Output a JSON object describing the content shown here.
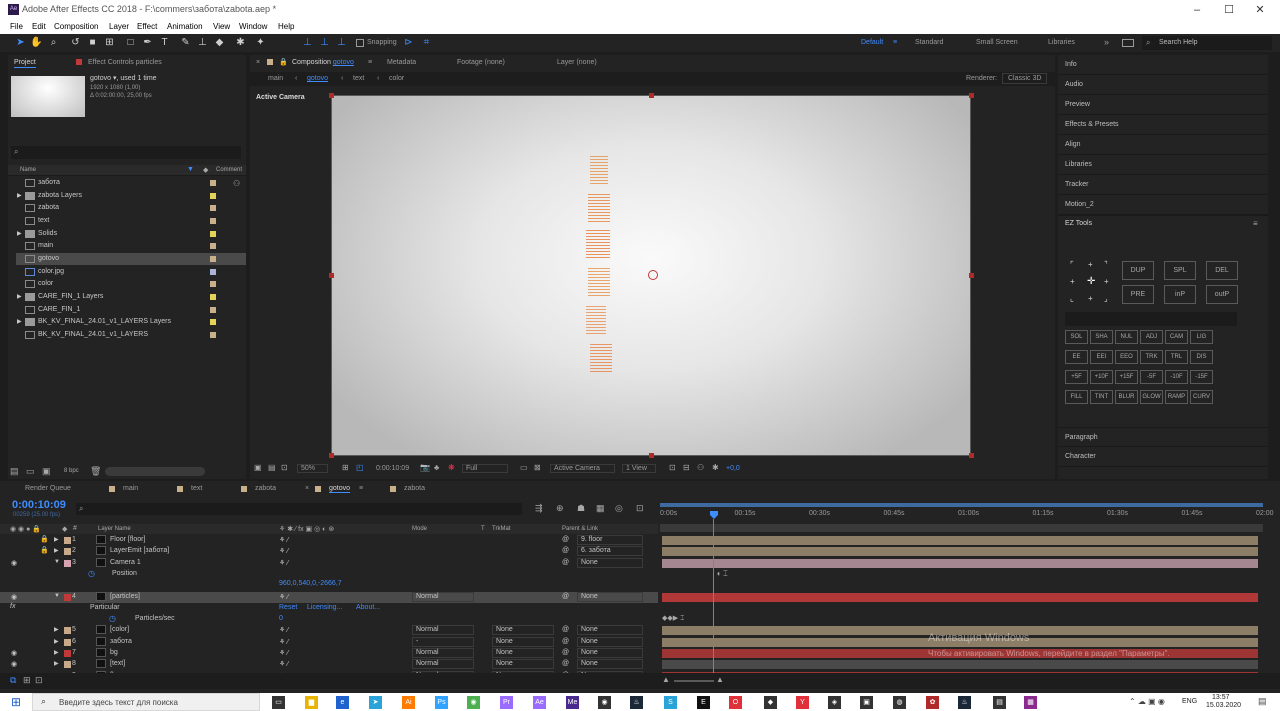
{
  "window": {
    "title": "Adobe After Effects CC 2018 - F:\\commers\\забота\\zabota.aep *",
    "app_icon": "Ae"
  },
  "menu": [
    "File",
    "Edit",
    "Composition",
    "Layer",
    "Effect",
    "Animation",
    "View",
    "Window",
    "Help"
  ],
  "toolbar": {
    "snapping": "Snapping",
    "workspaces": [
      "Default",
      "Standard",
      "Small Screen",
      "Libraries"
    ],
    "search_placeholder": "Search Help"
  },
  "project": {
    "tab": "Project",
    "effect_tab": "Effect Controls particles",
    "item_name": "gotovo",
    "used": ", used 1 time",
    "dims": "1920 x 1080 (1,00)",
    "duration": "Δ 0:02:00:00, 25,00 fps",
    "col_name": "Name",
    "col_comment": "Comment",
    "bpc": "8 bpc",
    "items": [
      {
        "name": "забота",
        "type": "comp",
        "color": "#c8b08a"
      },
      {
        "name": "zabota Layers",
        "type": "folder",
        "color": "#e3d35a"
      },
      {
        "name": "zabota",
        "type": "comp",
        "color": "#c8b08a"
      },
      {
        "name": "text",
        "type": "comp",
        "color": "#c8b08a"
      },
      {
        "name": "Solids",
        "type": "folder",
        "color": "#e3d35a"
      },
      {
        "name": "main",
        "type": "comp",
        "color": "#c8b08a"
      },
      {
        "name": "gotovo",
        "type": "comp",
        "color": "#c8b08a",
        "selected": true
      },
      {
        "name": "color.jpg",
        "type": "file",
        "color": "#a9b4d6"
      },
      {
        "name": "color",
        "type": "comp",
        "color": "#c8b08a"
      },
      {
        "name": "CARE_FIN_1 Layers",
        "type": "folder",
        "color": "#e3d35a"
      },
      {
        "name": "CARE_FIN_1",
        "type": "comp",
        "color": "#c8b08a"
      },
      {
        "name": "BK_KV_FINAL_24.01_v1_LAYERS Layers",
        "type": "folder",
        "color": "#e3d35a"
      },
      {
        "name": "BK_KV_FINAL_24.01_v1_LAYERS",
        "type": "comp",
        "color": "#c8b08a"
      }
    ]
  },
  "viewer": {
    "tab_prefix": "Composition",
    "tab_comp": "gotovo",
    "metadata": "Metadata",
    "footage": "Footage (none)",
    "layer": "Layer (none)",
    "breadcrumbs": [
      "main",
      "gotovo",
      "text",
      "color"
    ],
    "renderer_label": "Renderer:",
    "renderer": "Classic 3D",
    "active_camera": "Active Camera",
    "zoom": "50%",
    "timecode": "0:00:10:09",
    "resolution": "Full",
    "view": "Active Camera",
    "views": "1 View",
    "exposure": "+0,0"
  },
  "right_panels": [
    "Info",
    "Audio",
    "Preview",
    "Effects & Presets",
    "Align",
    "Libraries",
    "Tracker",
    "Motion_2"
  ],
  "ez_tools": {
    "title": "EZ Tools",
    "big": [
      "DUP",
      "SPL",
      "DEL",
      "PRE",
      "inP",
      "outP"
    ],
    "rows": [
      [
        "SOL",
        "SHA",
        "NUL",
        "ADJ",
        "CAM",
        "LIG"
      ],
      [
        "EE",
        "EEI",
        "EEO",
        "TRK",
        "TRL",
        "DIS"
      ],
      [
        "+5F",
        "+10F",
        "+15F",
        "-5F",
        "-10F",
        "-15F"
      ],
      [
        "FILL",
        "TINT",
        "BLUR",
        "GLOW",
        "RAMP",
        "CURV"
      ]
    ]
  },
  "bottom_panels": [
    "Paragraph",
    "Character"
  ],
  "timeline": {
    "tabs": [
      "Render Queue",
      "main",
      "text",
      "zabota",
      "gotovo",
      "zabota"
    ],
    "timecode": "0:00:10:09",
    "frames": "00259 (25.00 fps)",
    "headers": {
      "layer_name": "Layer Name",
      "mode": "Mode",
      "t": "T",
      "trkmat": "TrkMat",
      "parent": "Parent & Link"
    },
    "ruler": [
      "0:00s",
      "00:15s",
      "00:30s",
      "00:45s",
      "01:00s",
      "01:15s",
      "01:30s",
      "01:45s",
      "02:00"
    ],
    "rows": [
      {
        "num": "1",
        "name": "Floor [floor]",
        "color": "#c8a98a",
        "parent": "9. floor",
        "bar": "#8b7d66"
      },
      {
        "num": "2",
        "name": "LayerEmit [забота]",
        "color": "#c8a98a",
        "parent": "6. забота",
        "bar": "#8b7d66"
      },
      {
        "num": "3",
        "name": "Camera 1",
        "color": "#d6a3b0",
        "parent": "None",
        "bar": "#a48790"
      }
    ],
    "position_label": "Position",
    "position_value": "960,0,540,0,-2666,7",
    "particles": {
      "num": "4",
      "name": "[particles]",
      "mode": "Normal",
      "parent": "None"
    },
    "effect": {
      "name": "Particular",
      "reset": "Reset",
      "licensing": "Licensing...",
      "about": "About...",
      "prop": "Particles/sec",
      "prop_value": "0"
    },
    "rows2": [
      {
        "num": "5",
        "name": "[color]",
        "color": "#c8a98a",
        "mode": "Normal",
        "mat": "None",
        "parent": "None",
        "bar": "#8b7d66"
      },
      {
        "num": "6",
        "name": "забота",
        "color": "#c8a98a",
        "mode": "-",
        "mat": "None",
        "parent": "None",
        "bar": "#8b7d66"
      },
      {
        "num": "7",
        "name": "bg",
        "color": "#c03a3a",
        "mode": "Normal",
        "mat": "None",
        "parent": "None",
        "bar": "#9e3535"
      },
      {
        "num": "8",
        "name": "[text]",
        "color": "#c8a98a",
        "mode": "Normal",
        "mat": "None",
        "parent": "None",
        "bar": "#4a4a4a"
      },
      {
        "num": "9",
        "name": "floor",
        "color": "#c03a3a",
        "mode": "Normal",
        "mat": "None",
        "parent": "None",
        "bar": "#9e3535"
      }
    ]
  },
  "activation": {
    "title": "Активация Windows",
    "text": "Чтобы активировать Windows, перейдите в раздел \"Параметры\"."
  },
  "taskbar": {
    "search": "Введите здесь текст для поиска",
    "lang": "ENG",
    "time": "13:57",
    "date": "15.03.2020"
  }
}
